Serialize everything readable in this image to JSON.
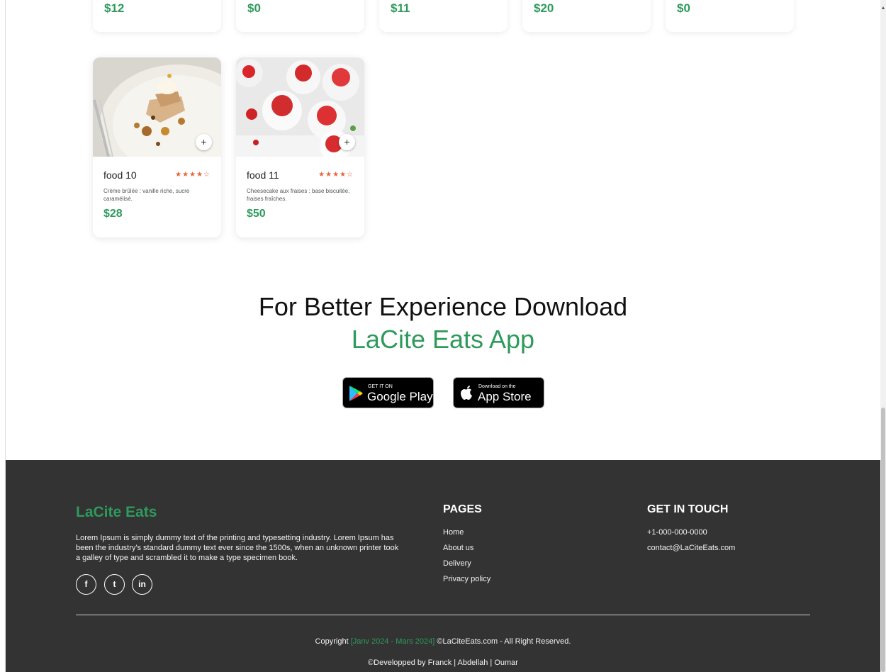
{
  "top_row": {
    "prices": [
      "$12",
      "$0",
      "$11",
      "$20",
      "$0"
    ]
  },
  "food_cards": [
    {
      "name": "food 10",
      "rating": 4,
      "stars": "★★★★☆",
      "description": "Crème brûlée : vanille riche, sucre caramélisé.",
      "price": "$28",
      "add_label": "+"
    },
    {
      "name": "food 11",
      "rating": 4,
      "stars": "★★★★☆",
      "description": "Cheesecake aux fraises : base biscuitée, fraises fraîches.",
      "price": "$50",
      "add_label": "+"
    }
  ],
  "download": {
    "title": "For Better Experience Download",
    "app_name": "LaCite Eats App",
    "google_play": {
      "small": "GET IT ON",
      "big": "Google Play"
    },
    "app_store": {
      "small": "Download on the",
      "big": "App Store"
    }
  },
  "footer": {
    "brand": "LaCite Eats",
    "about": "Lorem Ipsum is simply dummy text of the printing and typesetting industry. Lorem Ipsum has been the industry's standard dummy text ever since the 1500s, when an unknown printer took a galley of type and scrambled it to make a type specimen book.",
    "socials": [
      {
        "icon": "facebook-icon",
        "glyph": "f"
      },
      {
        "icon": "twitter-icon",
        "glyph": "t"
      },
      {
        "icon": "linkedin-icon",
        "glyph": "in"
      }
    ],
    "pages": {
      "title": "PAGES",
      "links": [
        "Home",
        "About us",
        "Delivery",
        "Privacy policy"
      ]
    },
    "contact": {
      "title": "GET IN TOUCH",
      "phone": "+1-000-000-0000",
      "email": "contact@LaCiteEats.com"
    },
    "copyright_prefix": "Copyright",
    "copyright_range": "[Janv 2024 - Mars 2024]",
    "copyright_suffix": "©LaCiteEats.com - All Right Reserved.",
    "developers": "©Developped by Franck | Abdellah | Oumar"
  },
  "colors": {
    "accent": "#2e9a5c",
    "star": "#e8633a",
    "footer_bg": "#333333"
  }
}
